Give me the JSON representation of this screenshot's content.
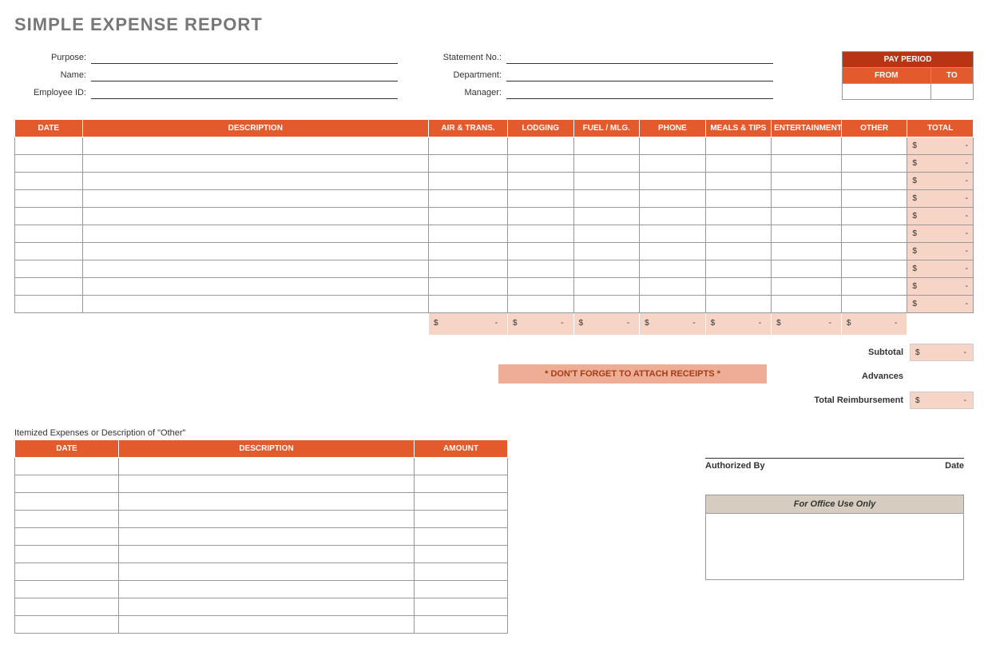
{
  "title": "SIMPLE EXPENSE REPORT",
  "colors": {
    "header_orange": "#e35a2c",
    "header_dark": "#b83514",
    "tint": "#f6d4c6",
    "reminder_bg": "#eeae95"
  },
  "info": {
    "left": [
      {
        "label": "Purpose:",
        "value": ""
      },
      {
        "label": "Name:",
        "value": ""
      },
      {
        "label": "Employee ID:",
        "value": ""
      }
    ],
    "mid": [
      {
        "label": "Statement No.:",
        "value": ""
      },
      {
        "label": "Department:",
        "value": ""
      },
      {
        "label": "Manager:",
        "value": ""
      }
    ]
  },
  "pay_period": {
    "title": "PAY PERIOD",
    "from_label": "FROM",
    "to_label": "TO",
    "from": "",
    "to": ""
  },
  "main_table": {
    "columns": [
      "DATE",
      "DESCRIPTION",
      "AIR & TRANS.",
      "LODGING",
      "FUEL / MLG.",
      "PHONE",
      "MEALS & TIPS",
      "ENTERTAINMENT",
      "OTHER",
      "TOTAL"
    ],
    "rows": 10,
    "row_total_display": {
      "currency": "$",
      "value": "-"
    },
    "column_totals_display": {
      "currency": "$",
      "value": "-"
    }
  },
  "reminder": "* DON'T FORGET TO ATTACH RECEIPTS *",
  "summary": {
    "subtotal_label": "Subtotal",
    "subtotal": {
      "currency": "$",
      "value": "-"
    },
    "advances_label": "Advances",
    "advances": "",
    "total_label": "Total Reimbursement",
    "total": {
      "currency": "$",
      "value": "-"
    }
  },
  "itemized": {
    "heading": "Itemized Expenses or Description of \"Other\"",
    "columns": [
      "DATE",
      "DESCRIPTION",
      "AMOUNT"
    ],
    "rows": 10
  },
  "signatures": {
    "authorized_by": "Authorized By",
    "date": "Date"
  },
  "office": {
    "heading": "For Office Use Only"
  }
}
